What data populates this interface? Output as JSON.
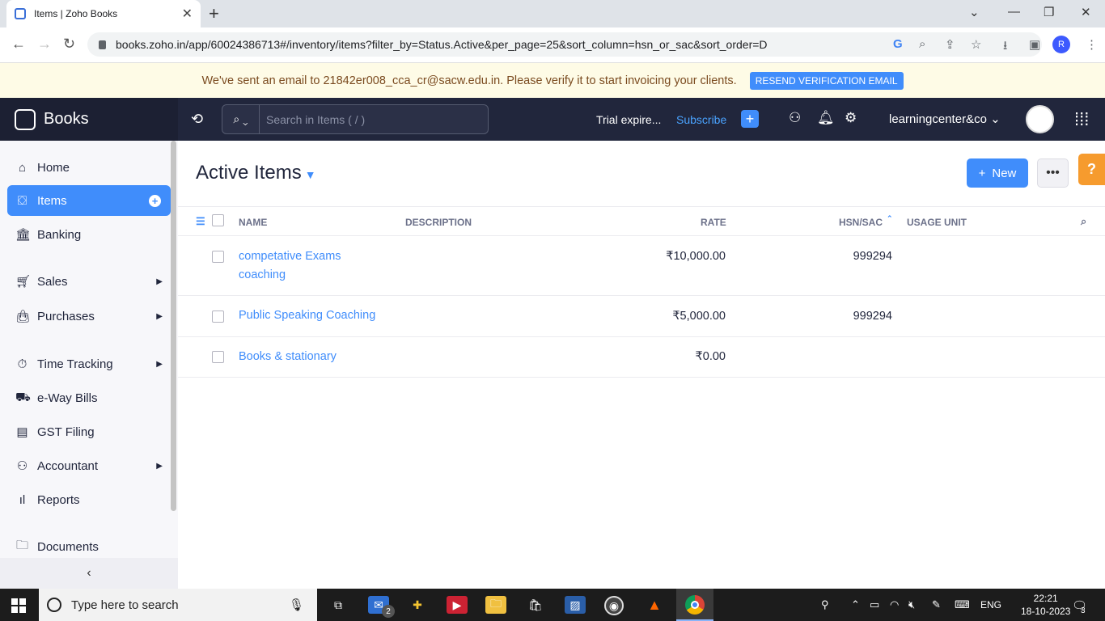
{
  "browser": {
    "tab_title": "Items | Zoho Books",
    "url": "books.zoho.in/app/60024386713#/inventory/items?filter_by=Status.Active&per_page=25&sort_column=hsn_or_sac&sort_order=D",
    "profile_initial": "R"
  },
  "banner": {
    "message": "We've sent an email to 21842er008_cca_cr@sacw.edu.in. Please verify it to start invoicing your clients.",
    "button": "RESEND VERIFICATION EMAIL"
  },
  "topbar": {
    "brand": "Books",
    "search_placeholder": "Search in Items ( / )",
    "trial": "Trial expire...",
    "subscribe": "Subscribe",
    "org": "learningcenter&co"
  },
  "sidebar": {
    "items": [
      {
        "label": "Home",
        "icon": "home-icon"
      },
      {
        "label": "Items",
        "icon": "basket-icon",
        "active": true
      },
      {
        "label": "Banking",
        "icon": "bank-icon"
      },
      {
        "label": "Sales",
        "icon": "cart-icon",
        "submenu": true
      },
      {
        "label": "Purchases",
        "icon": "bag-icon",
        "submenu": true
      },
      {
        "label": "Time Tracking",
        "icon": "timer-icon",
        "submenu": true
      },
      {
        "label": "e-Way Bills",
        "icon": "truck-icon"
      },
      {
        "label": "GST Filing",
        "icon": "gst-icon"
      },
      {
        "label": "Accountant",
        "icon": "accountant-icon",
        "submenu": true
      },
      {
        "label": "Reports",
        "icon": "reports-icon"
      },
      {
        "label": "Documents",
        "icon": "folder-icon"
      }
    ]
  },
  "main": {
    "title": "Active Items",
    "new_button": "New",
    "help": "?",
    "columns": {
      "name": "NAME",
      "description": "DESCRIPTION",
      "rate": "RATE",
      "hsn": "HSN/SAC",
      "unit": "USAGE UNIT"
    },
    "rows": [
      {
        "name_line1": "competative Exams",
        "name_line2": "coaching",
        "description": "",
        "rate": "₹10,000.00",
        "hsn": "999294",
        "unit": ""
      },
      {
        "name_line1": "Public Speaking Coaching",
        "name_line2": "",
        "description": "",
        "rate": "₹5,000.00",
        "hsn": "999294",
        "unit": ""
      },
      {
        "name_line1": "Books & stationary",
        "name_line2": "",
        "description": "",
        "rate": "₹0.00",
        "hsn": "",
        "unit": ""
      }
    ]
  },
  "taskbar": {
    "search_placeholder": "Type here to search",
    "mail_badge": "2",
    "language": "ENG",
    "time": "22:21",
    "date": "18-10-2023",
    "notification_count": "3"
  }
}
